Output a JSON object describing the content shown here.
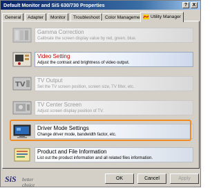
{
  "window": {
    "title": "Default Monitor and SiS 630/730 Properties",
    "help_label": "?",
    "close_label": "X"
  },
  "tabs": [
    {
      "label": "General"
    },
    {
      "label": "Adapter"
    },
    {
      "label": "Monitor"
    },
    {
      "label": "Troubleshoot"
    },
    {
      "label": "Color Management"
    },
    {
      "label": "Utility Manager",
      "icon": "sis-logo-icon",
      "active": true
    }
  ],
  "items": [
    {
      "title": "Gamma Correction",
      "desc": "Calibrate the screen display value by red, green, blue.",
      "icon": "gamma-icon",
      "disabled": true
    },
    {
      "title": "Video Setting",
      "desc": "Adjust the contrast and brightness of video output.",
      "icon": "video-setting-icon",
      "disabled": false
    },
    {
      "title": "TV Output",
      "desc": "Set the TV screen position, screen size, TV filter, etc.",
      "icon": "tv-output-icon",
      "disabled": true
    },
    {
      "title": "TV Center Screen",
      "desc": "Adjust screen display position of TV.",
      "icon": "tv-center-icon",
      "disabled": true
    },
    {
      "title": "Driver Mode Settings",
      "desc": "Change driver mode, bandwidth factor, etc.",
      "icon": "driver-mode-icon",
      "disabled": false,
      "selected": true
    },
    {
      "title": "Product and File Information",
      "desc": "List out the product information and all related files information.",
      "icon": "product-info-icon",
      "disabled": false
    }
  ],
  "footer": {
    "logo": "SiS",
    "tagline": "better choice",
    "ok_label": "OK",
    "cancel_label": "Cancel",
    "apply_label": "Apply"
  },
  "colors": {
    "title_start": "#0a246a",
    "face": "#d4d0c8",
    "selection_ring": "#f08a24",
    "link_red": "#c00000"
  }
}
